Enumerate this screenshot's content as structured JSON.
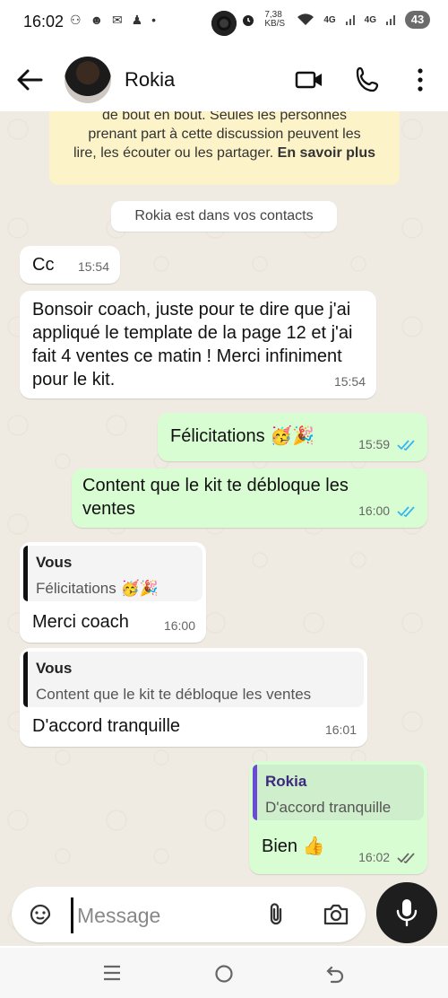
{
  "status": {
    "time": "16:02",
    "left_icons": "⚇ ☻ ✉ ♟ •",
    "net_speed": "7,38 KB/S",
    "signal1": "4G",
    "signal2": "4G",
    "battery": "43",
    "colors": {
      "text": "#111111"
    }
  },
  "header": {
    "contact_name": "Rokia",
    "icons": [
      "back-arrow-icon",
      "video-call-icon",
      "phone-icon",
      "more-vert-icon"
    ]
  },
  "notice": {
    "line1": "de bout en bout. Seules les personnes",
    "line2": "prenant part à cette discussion peuvent les",
    "line3": "lire, les écouter ou les partager.",
    "link": "En savoir plus"
  },
  "contact_pill": "Rokia est dans vos contacts",
  "messages": [
    {
      "dir": "in",
      "text": "Cc",
      "time": "15:54"
    },
    {
      "dir": "in",
      "text": "Bonsoir coach, juste pour te dire que j'ai appliqué le template de la page 12 et j'ai fait 4 ventes ce matin ! Merci infiniment pour le kit.",
      "time": "15:54"
    },
    {
      "dir": "out",
      "text": "Félicitations 🥳🎉",
      "time": "15:59",
      "read": true
    },
    {
      "dir": "out",
      "text": "Content que le kit te débloque les ventes",
      "time": "16:00",
      "read": true
    },
    {
      "dir": "in",
      "quote_author": "Vous",
      "quote_text": "Félicitations 🥳🎉",
      "text": "Merci coach",
      "time": "16:00"
    },
    {
      "dir": "in",
      "quote_author": "Vous",
      "quote_text": "Content que le kit te débloque les ventes",
      "text": "D'accord tranquille",
      "time": "16:01"
    },
    {
      "dir": "out",
      "quote_author": "Rokia",
      "quote_text": "D'accord tranquille",
      "text": "Bien 👍",
      "time": "16:02",
      "read": false
    }
  ],
  "composer": {
    "placeholder": "Message",
    "icons": [
      "emoji-sticker-icon",
      "attach-icon",
      "camera-icon",
      "mic-icon"
    ]
  },
  "accent": {
    "read_ticks": "#34b7f1",
    "sent_bubble": "#d9fdd3",
    "quote_bar": "#6b4bd6"
  }
}
